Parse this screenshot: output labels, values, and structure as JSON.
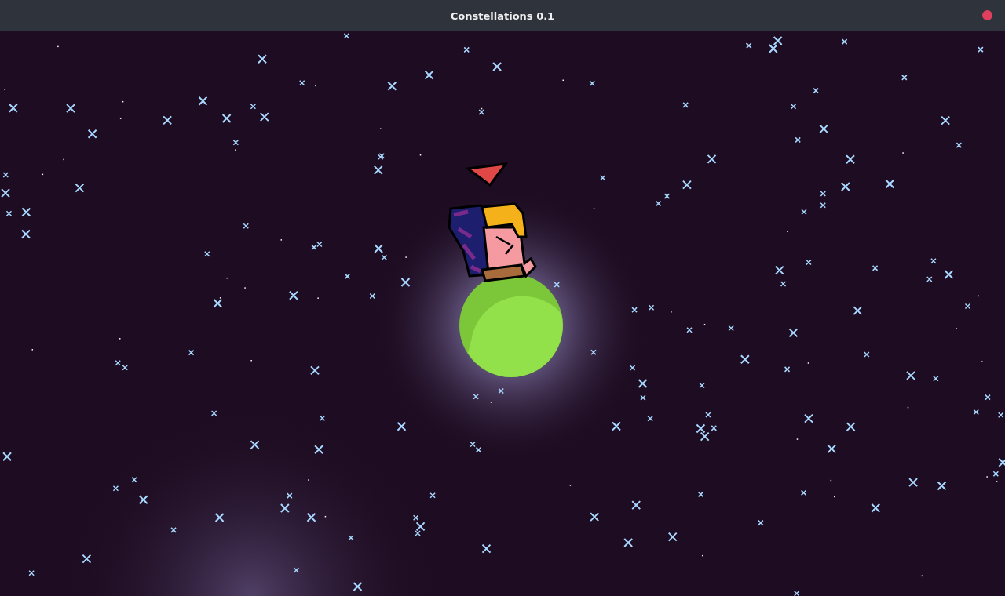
{
  "window": {
    "title": "Constellations 0.1"
  }
}
